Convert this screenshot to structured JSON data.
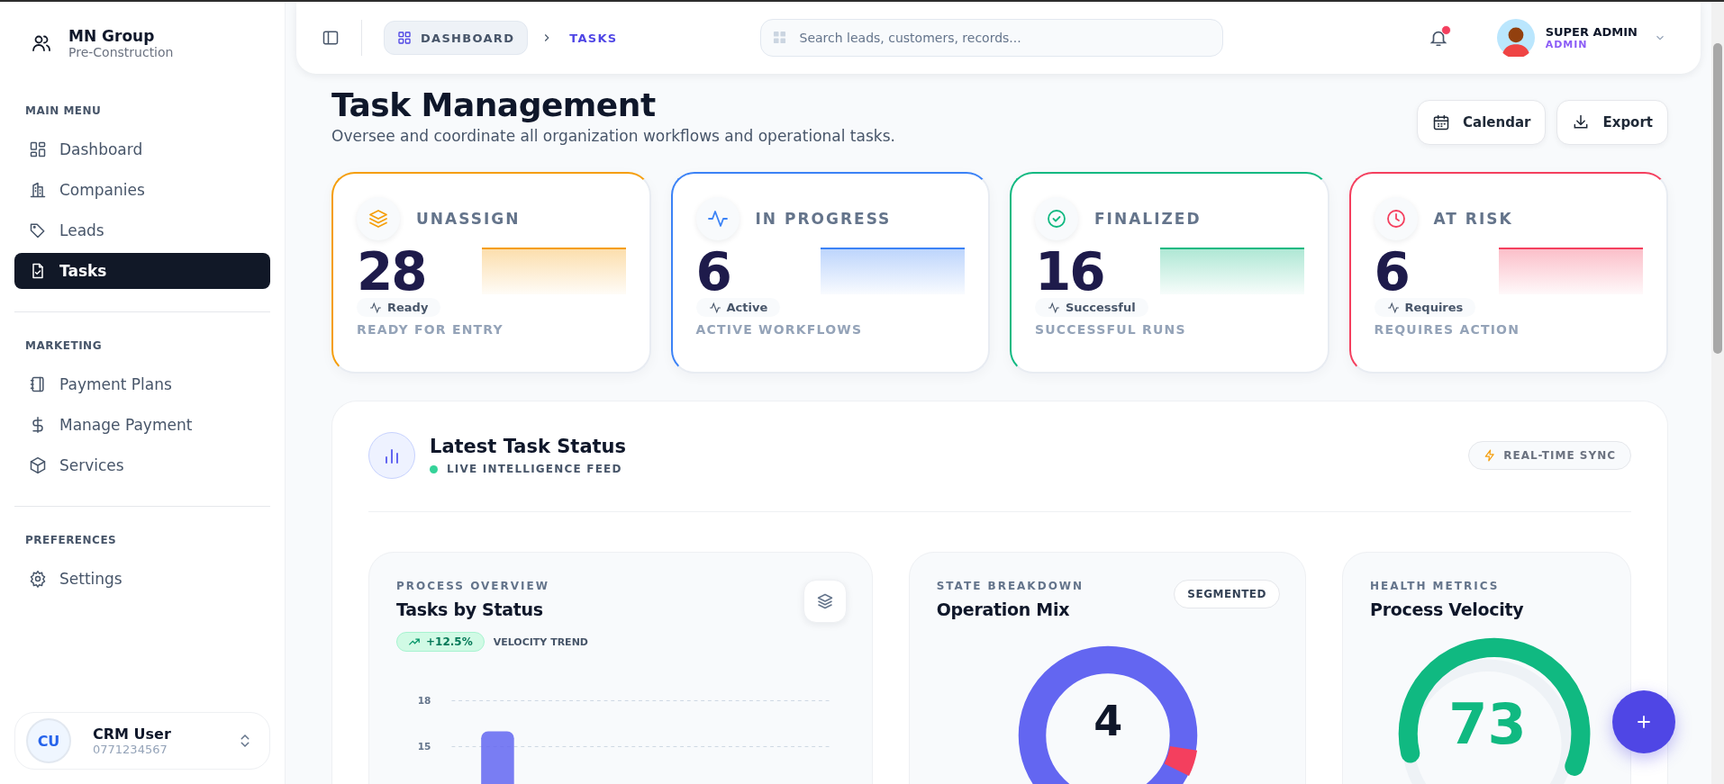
{
  "sidebar": {
    "brand": {
      "name": "MN Group",
      "subtitle": "Pre-Construction"
    },
    "sections": [
      {
        "heading": "MAIN MENU",
        "items": [
          {
            "label": "Dashboard",
            "kind": "grid",
            "selected": false
          },
          {
            "label": "Companies",
            "kind": "building",
            "selected": false
          },
          {
            "label": "Leads",
            "kind": "tag",
            "selected": false
          },
          {
            "label": "Tasks",
            "kind": "file-check",
            "selected": true
          }
        ]
      },
      {
        "heading": "MARKETING",
        "items": [
          {
            "label": "Payment Plans",
            "kind": "notebook",
            "selected": false
          },
          {
            "label": "Manage Payment",
            "kind": "dollar",
            "selected": false
          },
          {
            "label": "Services",
            "kind": "box",
            "selected": false
          }
        ]
      },
      {
        "heading": "PREFERENCES",
        "items": [
          {
            "label": "Settings",
            "kind": "gear",
            "selected": false
          }
        ]
      }
    ],
    "user": {
      "initials": "CU",
      "name": "CRM User",
      "phone": "0771234567"
    }
  },
  "header": {
    "breadcrumb": [
      {
        "label": "DASHBOARD",
        "selected": false
      },
      {
        "label": "TASKS",
        "selected": true
      }
    ],
    "search": {
      "placeholder": "Search leads, customers, records..."
    },
    "notification_unread": true,
    "profile": {
      "name": "SUPER ADMIN",
      "role": "ADMIN"
    }
  },
  "page": {
    "title": "Task Management",
    "subtitle": "Oversee and coordinate all organization workflows and operational tasks.",
    "actions": [
      {
        "label": "Calendar",
        "kind": "calendar"
      },
      {
        "label": "Export",
        "kind": "download"
      }
    ]
  },
  "stats": [
    {
      "kind": "layers",
      "label": "UNASSIGN",
      "value": "28",
      "badge": "Ready",
      "caption": "READY FOR ENTRY",
      "color": "#f59e0b"
    },
    {
      "kind": "pulse",
      "label": "IN PROGRESS",
      "value": "6",
      "badge": "Active",
      "caption": "ACTIVE WORKFLOWS",
      "color": "#3b82f6"
    },
    {
      "kind": "check",
      "label": "FINALIZED",
      "value": "16",
      "badge": "Successful",
      "caption": "SUCCESSFUL RUNS",
      "color": "#10b981"
    },
    {
      "kind": "clock",
      "label": "AT RISK",
      "value": "6",
      "badge": "Requires",
      "caption": "REQUIRES ACTION",
      "color": "#f43f5e"
    }
  ],
  "status_section": {
    "title": "Latest Task Status",
    "feed": "LIVE INTELLIGENCE FEED",
    "sync": "REAL-TIME SYNC",
    "panels": [
      {
        "kind": "bar",
        "eyebrow": "PROCESS OVERVIEW",
        "title": "Tasks by Status",
        "trend": "+12.5%",
        "trend_label": "VELOCITY TREND",
        "chart_data": {
          "type": "bar",
          "ylim": [
            0,
            18
          ],
          "yticks": [
            15,
            18
          ],
          "values": [
            16
          ]
        }
      },
      {
        "kind": "donut",
        "eyebrow": "STATE BREAKDOWN",
        "title": "Operation Mix",
        "chip": "SEGMENTED",
        "center": "4"
      },
      {
        "kind": "gauge",
        "eyebrow": "HEALTH METRICS",
        "title": "Process Velocity",
        "center": "73"
      }
    ]
  }
}
